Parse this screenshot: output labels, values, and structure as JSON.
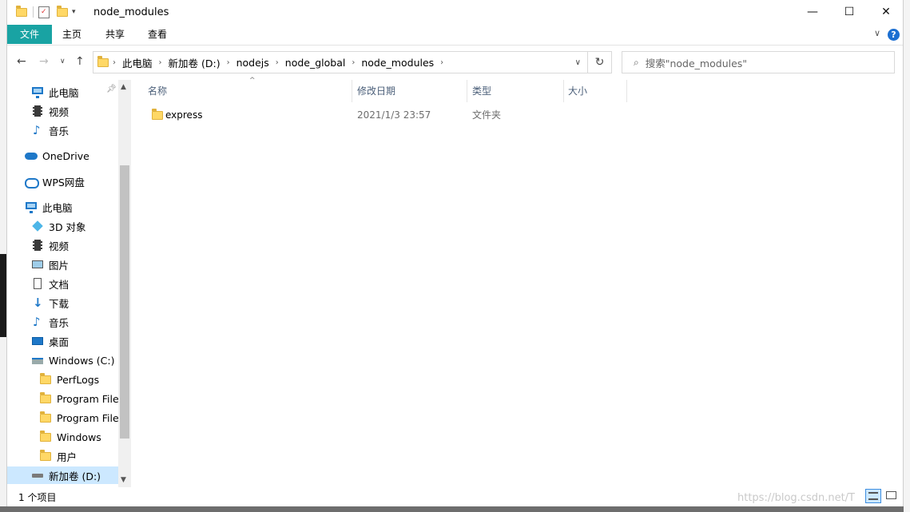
{
  "window": {
    "title": "node_modules",
    "controls": {
      "minimize": "—",
      "maximize": "☐",
      "close": "✕"
    }
  },
  "ribbon": {
    "tabs": [
      "文件",
      "主页",
      "共享",
      "查看"
    ],
    "help": "?"
  },
  "address": {
    "crumbs": [
      "此电脑",
      "新加卷 (D:)",
      "nodejs",
      "node_global",
      "node_modules"
    ],
    "search_placeholder": "搜索\"node_modules\""
  },
  "nav_pane": {
    "items": [
      {
        "label": "此电脑",
        "icon": "pc-icon"
      },
      {
        "label": "视频",
        "icon": "video-icon"
      },
      {
        "label": "音乐",
        "icon": "music-icon"
      },
      {
        "label": "OneDrive",
        "icon": "onedrive-icon"
      },
      {
        "label": "WPS网盘",
        "icon": "wps-cloud-icon"
      },
      {
        "label": "此电脑",
        "icon": "pc-icon"
      },
      {
        "label": "3D 对象",
        "icon": "3d-objects-icon"
      },
      {
        "label": "视频",
        "icon": "video-icon"
      },
      {
        "label": "图片",
        "icon": "pictures-icon"
      },
      {
        "label": "文档",
        "icon": "documents-icon"
      },
      {
        "label": "下载",
        "icon": "downloads-icon"
      },
      {
        "label": "音乐",
        "icon": "music-icon"
      },
      {
        "label": "桌面",
        "icon": "desktop-icon"
      },
      {
        "label": "Windows (C:)",
        "icon": "drive-c-icon"
      },
      {
        "label": "PerfLogs",
        "icon": "folder-icon"
      },
      {
        "label": "Program Files",
        "icon": "folder-icon"
      },
      {
        "label": "Program Files",
        "icon": "folder-icon"
      },
      {
        "label": "Windows",
        "icon": "folder-icon"
      },
      {
        "label": "用户",
        "icon": "folder-icon"
      },
      {
        "label": "新加卷 (D:)",
        "icon": "drive-icon",
        "selected": true
      }
    ]
  },
  "columns": [
    "名称",
    "修改日期",
    "类型",
    "大小"
  ],
  "files": [
    {
      "name": "express",
      "modified": "2021/1/3 23:57",
      "type": "文件夹",
      "size": ""
    }
  ],
  "status": {
    "count": "1 个项目",
    "watermark": "https://blog.csdn.net/T"
  }
}
